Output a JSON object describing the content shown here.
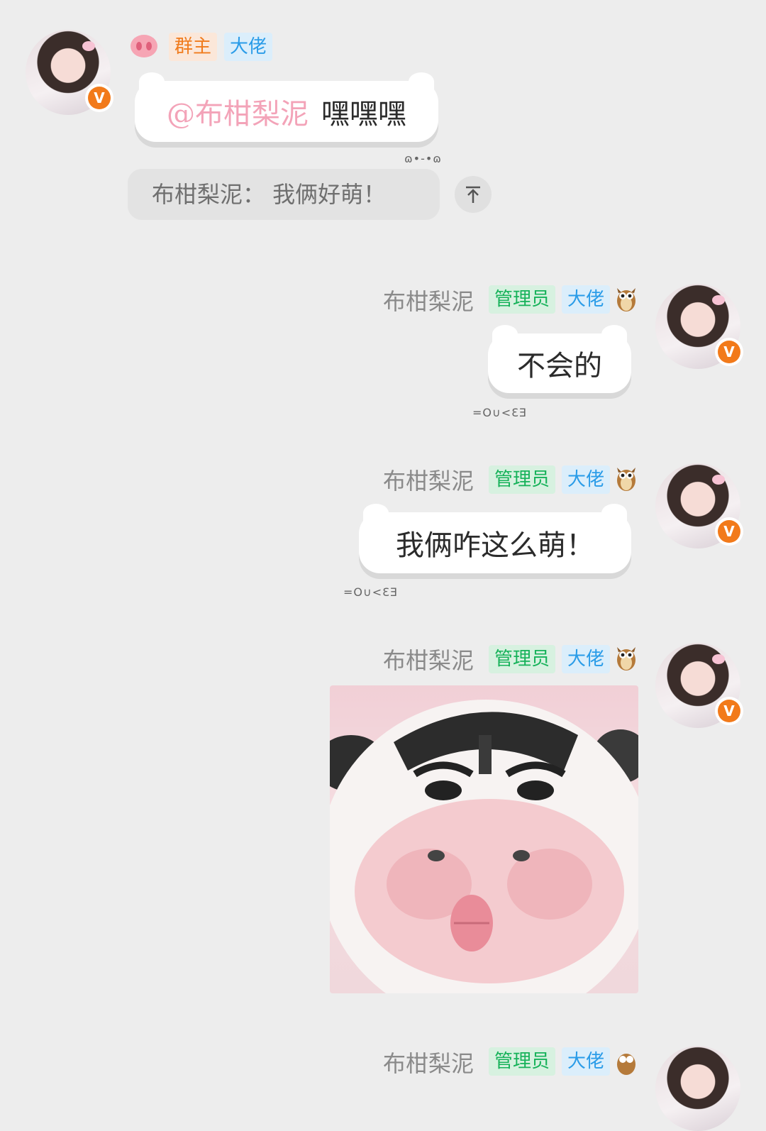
{
  "messages": [
    {
      "side": "left",
      "badges": [
        "群主",
        "大佬"
      ],
      "text_mention": "@布柑梨泥",
      "text": "嘿嘿嘿",
      "kaomoji": "ɷ•-•ɷ",
      "quote": "布柑梨泥：  我俩好萌！"
    },
    {
      "side": "right",
      "nickname": "布柑梨泥",
      "badges": [
        "管理员",
        "大佬"
      ],
      "text": "不会的",
      "kaomoji": "=O∪<ƐƎ"
    },
    {
      "side": "right",
      "nickname": "布柑梨泥",
      "badges": [
        "管理员",
        "大佬"
      ],
      "text": "我俩咋这么萌！",
      "kaomoji": "=O∪<ƐƎ"
    },
    {
      "side": "right",
      "nickname": "布柑梨泥",
      "badges": [
        "管理员",
        "大佬"
      ],
      "sticker": "cow-face-sticker"
    },
    {
      "side": "right",
      "nickname": "布柑梨泥",
      "badges": [
        "管理员",
        "大佬"
      ]
    }
  ],
  "colors": {
    "background": "#ededed",
    "owner_tag": "#f07b1d",
    "admin_tag": "#17b25a",
    "boss_tag": "#2a9ce8",
    "mention": "#f3a3b8",
    "verified_badge": "#f27a1a"
  },
  "icons": [
    "pig-nose-icon",
    "owl-icon",
    "verified-v-icon",
    "scroll-to-top-arrow-icon"
  ],
  "v_label": "V"
}
